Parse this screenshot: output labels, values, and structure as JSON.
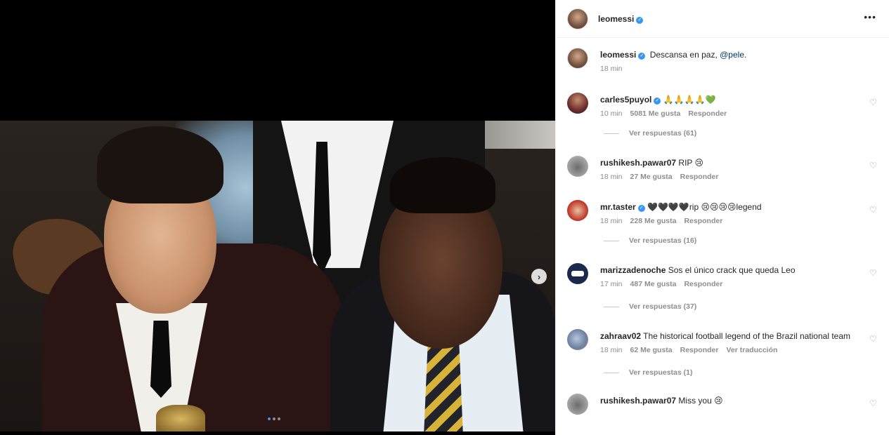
{
  "post": {
    "author": "leomessi",
    "carousel_dots": 3,
    "active_dot": 0
  },
  "header": {
    "username": "leomessi",
    "more_icon": "more-horizontal-icon"
  },
  "caption": {
    "username": "leomessi",
    "text": "Descansa en paz, ",
    "mention": "@pele",
    "text_after": ".",
    "time": "18 min"
  },
  "comments": [
    {
      "username": "carles5puyol",
      "verified": true,
      "text": "🙏🙏🙏🙏💚",
      "time": "10 min",
      "likes": "5081 Me gusta",
      "reply": "Responder",
      "view_replies": "Ver respuestas (61)"
    },
    {
      "username": "rushikesh.pawar07",
      "verified": false,
      "text": "RIP 😢",
      "time": "18 min",
      "likes": "27 Me gusta",
      "reply": "Responder",
      "view_replies": ""
    },
    {
      "username": "mr.taster",
      "verified": true,
      "text": "🖤🖤🖤🖤rip 😢😢😢😢legend",
      "time": "18 min",
      "likes": "228 Me gusta",
      "reply": "Responder",
      "view_replies": "Ver respuestas (16)"
    },
    {
      "username": "marizzadenoche",
      "verified": false,
      "text": "Sos el único crack que queda Leo",
      "time": "17 min",
      "likes": "487 Me gusta",
      "reply": "Responder",
      "view_replies": "Ver respuestas (37)"
    },
    {
      "username": "zahraav02",
      "verified": false,
      "text": "The historical football legend of the Brazil national team",
      "time": "18 min",
      "likes": "62 Me gusta",
      "reply": "Responder",
      "translate": "Ver traducción",
      "view_replies": "Ver respuestas (1)"
    },
    {
      "username": "rushikesh.pawar07",
      "verified": false,
      "text": "Miss you 😢",
      "time": "",
      "likes": "",
      "reply": "",
      "view_replies": ""
    }
  ],
  "colors": {
    "verified": "#3897f0",
    "mention": "#00376b",
    "muted": "#8e8e8e"
  }
}
